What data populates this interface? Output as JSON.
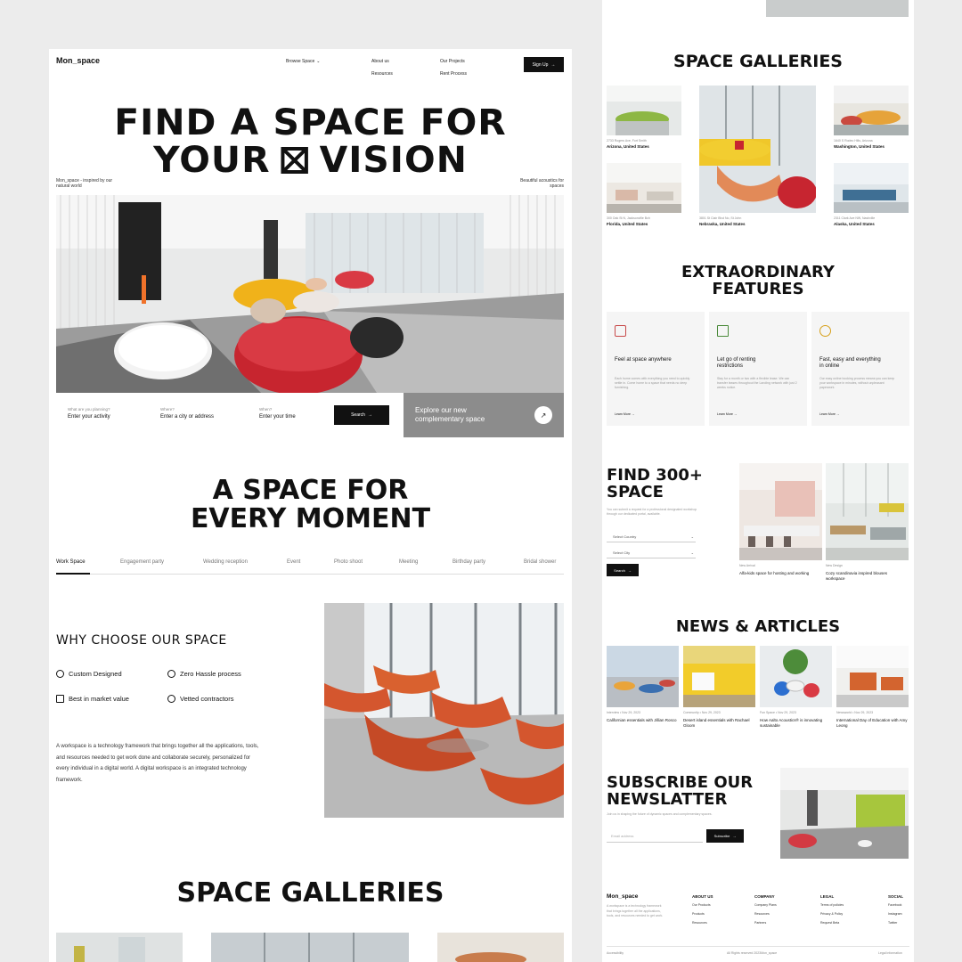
{
  "header": {
    "logo": "Mon_space",
    "browse": "Browse Space",
    "nav": [
      "About us",
      "Resources",
      "Our Projects",
      "Rent Process"
    ],
    "signup": "Sign Up"
  },
  "hero": {
    "line1": "FIND A SPACE FOR",
    "line2a": "YOUR",
    "line2b": "VISION",
    "left_note": "Mon_space - inspired by our natural world",
    "right_note": "Beautiful acoustics for spaces"
  },
  "search": {
    "fields": [
      {
        "label": "What are you planning?",
        "value": "Enter your activity"
      },
      {
        "label": "Where?",
        "value": "Enter a city or address"
      },
      {
        "label": "When?",
        "value": "Enter your time"
      }
    ],
    "button": "Search",
    "explore": "Explore our new complementary space"
  },
  "moment": {
    "line1": "A SPACE FOR",
    "line2": "EVERY MOMENT",
    "tabs": [
      "Work Space",
      "Engagement party",
      "Wedding reception",
      "Event",
      "Photo shoot",
      "Meeting",
      "Birthday party",
      "Bridal shower"
    ]
  },
  "why": {
    "title": "WHY CHOOSE OUR SPACE",
    "features": [
      "Custom Designed",
      "Zero Hassle process",
      "Best in market value",
      "Vetted contractors"
    ],
    "body": "A workspace is a technology framework that brings together all the applications, tools, and resources needed to get work done and collaborate securely, personalized for every individual in a digital world. A digital workspace is an integrated technology framework."
  },
  "galleries": {
    "title": "SPACE GALLERIES",
    "items": [
      {
        "addr": "2733 Rogers Ave, Fort Smith",
        "loc": "Arizona, United States"
      },
      {
        "addr": "1640 S Rodeo Hills, Arizona",
        "loc": "Washington, United States"
      },
      {
        "addr": "300 Oak St N, Jacksonville Bch",
        "loc": "Florida, United States"
      },
      {
        "addr": "3801 St Clair Blvd No, St John",
        "loc": "Nebraska, United States"
      },
      {
        "addr": "2311 Clark Ave NW, Nashville",
        "loc": "Alaska, United States"
      }
    ]
  },
  "features": {
    "line1": "EXTRAORDINARY",
    "line2": "FEATURES",
    "cards": [
      {
        "title": "Feel at space anywhere",
        "body": "Each home comes with everything you need to quickly settle in. Come home to a space that needs no deep furnishing.",
        "link": "Learn More",
        "icon": "map-icon"
      },
      {
        "title": "Let go of renting restrictions",
        "body": "Stay for a month or two with a flexible lease. We can transfer leases throughout the Landing network with just 2 weeks notice.",
        "link": "Learn More",
        "icon": "building-icon"
      },
      {
        "title": "Fast, easy and everything in online",
        "body": "Our easy online booking process means you can keep your workspace in minutes, without unpleasant paperwork.",
        "link": "Learn More",
        "icon": "globe-icon"
      }
    ]
  },
  "find": {
    "line1": "FIND 300+",
    "line2": "SPACE",
    "desc": "You can submit a request for a professional designated workshop through our dedicated portal, available.",
    "select1": "Select Country",
    "select2": "Select City",
    "button": "Search",
    "items": [
      {
        "tag": "New Arrival",
        "title": "Alfa-kids space for hosting and working"
      },
      {
        "tag": "New Design",
        "title": "Cozy scandinavia inspired blouses workspace"
      }
    ]
  },
  "news": {
    "title": "NEWS & ARTICLES",
    "items": [
      {
        "meta": "Interview  •  Nov 29, 2023",
        "title": "Californian essentials with Jillian Rosco"
      },
      {
        "meta": "Community  •  Nov 29, 2023",
        "title": "Desert island essentials with Rachael Gloom"
      },
      {
        "meta": "Fun Space  •  Nov 29, 2023",
        "title": "How Aalto Acoustics® is innovating sustainable"
      },
      {
        "meta": "Newsworld  •  Nov 29, 2023",
        "title": "International Day of Education with Amy Leong"
      }
    ]
  },
  "newsletter": {
    "line1": "SUBSCRIBE OUR",
    "line2": "NEWSLATTER",
    "desc": "Join us in shaping the future of dynamic spaces and complementary spaces.",
    "placeholder": "Email address",
    "button": "Subscribe"
  },
  "footer": {
    "logo": "Mon_space",
    "desc": "A workspace is a technology framework that brings together all the applications, tools, and resources needed to get work.",
    "cols": [
      {
        "head": "ABOUT US",
        "items": [
          "Our Products",
          "Products",
          "Resources"
        ]
      },
      {
        "head": "COMPANY",
        "items": [
          "Company Plans",
          "Resources",
          "Partners"
        ]
      },
      {
        "head": "LEGAL",
        "items": [
          "Terms of policies",
          "Privacy & Policy",
          "Request Beta"
        ]
      },
      {
        "head": "SOCIAL",
        "items": [
          "Facebook",
          "Instagram",
          "Twitter"
        ]
      }
    ],
    "accessibility": "Accessibility",
    "copyright": "All Rights reserved 2023Mon_space",
    "legal": "Legal information"
  },
  "colors": {
    "accent": "#111111",
    "red": "#d6303a",
    "yellow": "#f3b21b",
    "orange": "#d9552c",
    "green": "#9bc53d"
  }
}
